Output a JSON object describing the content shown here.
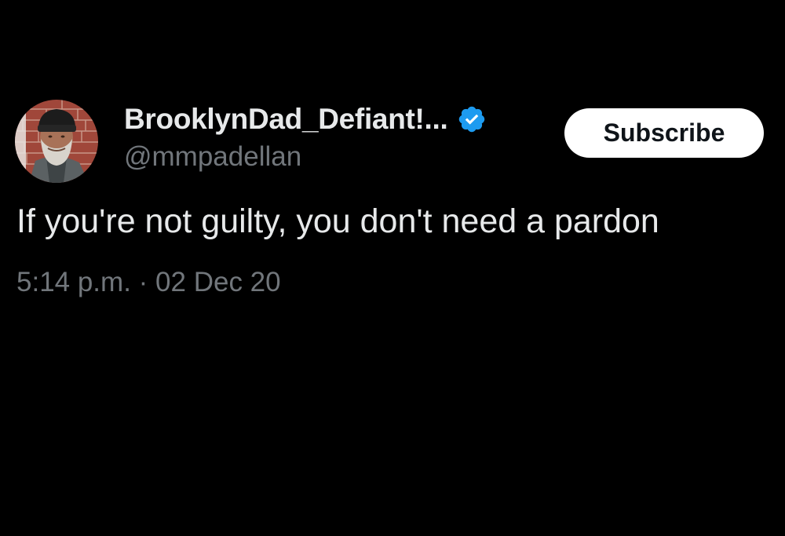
{
  "tweet": {
    "author": {
      "display_name": "BrooklynDad_Defiant!...",
      "handle": "@mmpadellan",
      "verified": true,
      "avatar_icon": "profile-photo-icon"
    },
    "subscribe_label": "Subscribe",
    "text": "If you're not guilty, you don't need a pardon",
    "time": "5:14 p.m.",
    "separator": "·",
    "date": "02 Dec 20"
  },
  "colors": {
    "background": "#000000",
    "primary_text": "#e7e9ea",
    "secondary_text": "#71767b",
    "verified_badge": "#1d9bf0",
    "button_bg": "#ffffff",
    "button_text": "#0f1419"
  }
}
